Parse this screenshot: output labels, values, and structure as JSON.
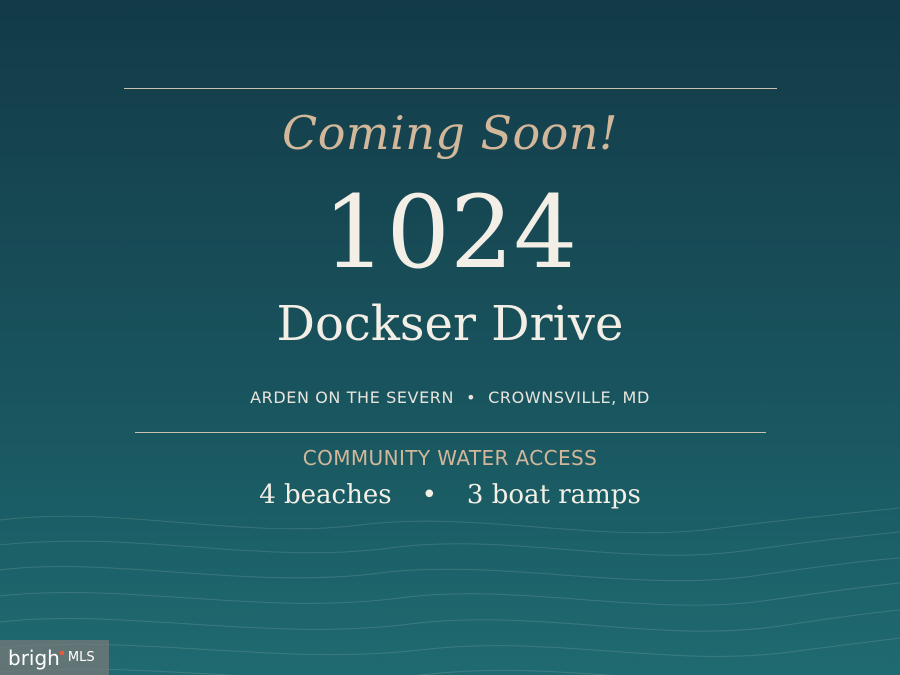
{
  "headline": "Coming Soon!",
  "address": {
    "number": "1024",
    "street": "Dockser Drive"
  },
  "location": {
    "community": "ARDEN ON THE SEVERN",
    "separator": "•",
    "city": "CROWNSVILLE, MD"
  },
  "amenities": {
    "title": "COMMUNITY WATER ACCESS",
    "beaches": "4 beaches",
    "separator": "•",
    "ramps": "3 boat ramps"
  },
  "badge": {
    "brand": "brigh",
    "mls": "MLS"
  },
  "colors": {
    "accent": "#d2b79a",
    "text": "#f3efe6",
    "background_top": "#123a47",
    "background_bottom": "#1f6a70"
  }
}
